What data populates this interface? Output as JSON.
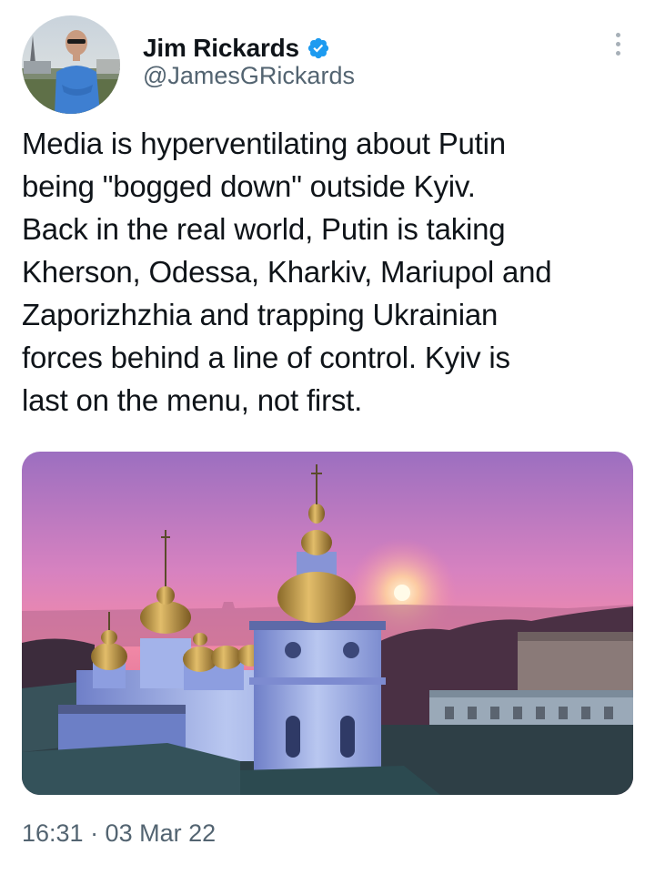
{
  "author": {
    "display_name": "Jim Rickards",
    "handle": "@JamesGRickards",
    "verified": true,
    "avatar_icon": "avatar-photo"
  },
  "tweet": {
    "text": "Media is hyperventilating about Putin\nbeing \"bogged down\" outside Kyiv.\nBack in the real world, Putin is taking\nKherson, Odessa, Kharkiv, Mariupol and\nZaporizhzhia and trapping Ukrainian\nforces behind a line of control. Kyiv is\nlast on the menu, not first.",
    "timestamp": "16:31 · 03 Mar 22"
  },
  "media": {
    "description_icon": "photo-image"
  },
  "colors": {
    "verified_blue": "#1d9bf0",
    "secondary_text": "#536471",
    "primary_text": "#0f1419"
  }
}
